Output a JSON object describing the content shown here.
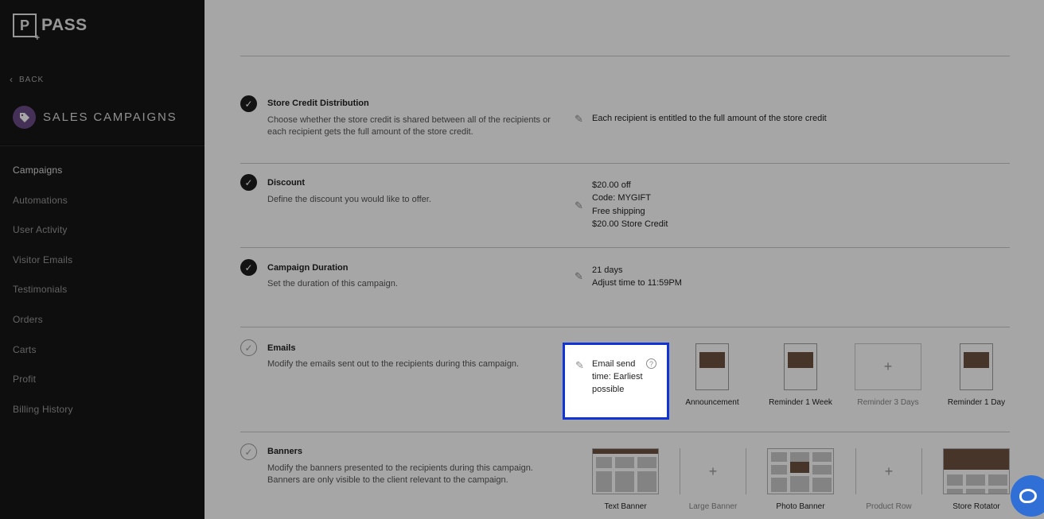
{
  "brand": {
    "logo_letter": "P",
    "name": "PASS"
  },
  "sidebar": {
    "back_label": "BACK",
    "section_title": "SALES CAMPAIGNS",
    "items": [
      {
        "label": "Campaigns"
      },
      {
        "label": "Automations"
      },
      {
        "label": "User Activity"
      },
      {
        "label": "Visitor Emails"
      },
      {
        "label": "Testimonials"
      },
      {
        "label": "Orders"
      },
      {
        "label": "Carts"
      },
      {
        "label": "Profit"
      },
      {
        "label": "Billing History"
      }
    ]
  },
  "steps": {
    "store_credit": {
      "title": "Store Credit Distribution",
      "desc": "Choose whether the store credit is shared between all of the recipients or each recipient gets the full amount of the store credit.",
      "value": "Each recipient is entitled to the full amount of the store credit"
    },
    "discount": {
      "title": "Discount",
      "desc": "Define the discount you would like to offer.",
      "values": [
        "$20.00 off",
        "Code: MYGIFT",
        "Free shipping",
        "$20.00 Store Credit"
      ]
    },
    "duration": {
      "title": "Campaign Duration",
      "desc": "Set the duration of this campaign.",
      "values": [
        "21 days",
        "Adjust time to 11:59PM"
      ]
    },
    "emails": {
      "title": "Emails",
      "desc": "Modify the emails sent out to the recipients during this campaign.",
      "send_time": "Email send time: Earliest possible",
      "help": "?",
      "templates": [
        {
          "label": "Announcement"
        },
        {
          "label": "Reminder 1 Week"
        },
        {
          "label": "Reminder 3 Days"
        },
        {
          "label": "Reminder 1 Day"
        }
      ],
      "add_glyph": "+"
    },
    "banners": {
      "title": "Banners",
      "desc": "Modify the banners presented to the recipients during this campaign. Banners are only visible to the client relevant to the campaign.",
      "items": [
        {
          "label": "Text Banner"
        },
        {
          "label": "Large Banner"
        },
        {
          "label": "Photo Banner"
        },
        {
          "label": "Product Row"
        },
        {
          "label": "Store Rotator"
        }
      ],
      "add_glyph": "+"
    }
  },
  "icons": {
    "check": "✓",
    "pencil": "✎",
    "chevron_left": "‹",
    "tag": "🏷"
  }
}
